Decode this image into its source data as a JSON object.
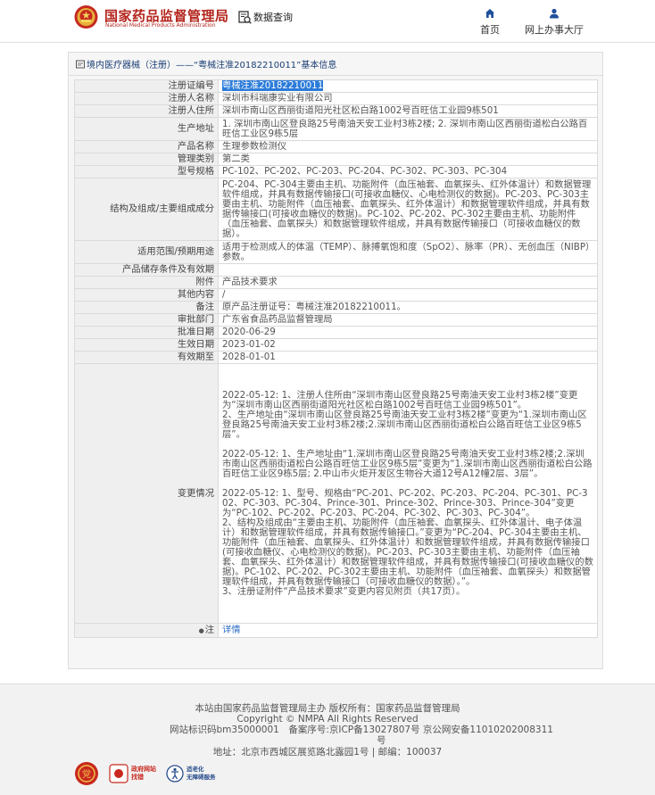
{
  "header": {
    "logo_cn": "国家药品监督管理局",
    "logo_en": "National Medical Products Administration",
    "nav_query": "数据查询",
    "nav_home": "首页",
    "nav_online": "网上办事大厅"
  },
  "panel": {
    "title": "境内医疗器械（注册）——“粤械注准20182210011”基本信息"
  },
  "rows": [
    {
      "key": "注册证编号",
      "value": "粤械注准20182210011"
    },
    {
      "key": "注册人名称",
      "value": "深圳市科瑞康实业有限公司"
    },
    {
      "key": "注册人住所",
      "value": "深圳市南山区西丽街道阳光社区松白路1002号百旺信工业园9栋501"
    },
    {
      "key": "生产地址",
      "value": "1. 深圳市南山区登良路25号南油天安工业村3栋2楼; 2. 深圳市南山区西丽街道松白公路百旺信工业区9栋5层"
    },
    {
      "key": "产品名称",
      "value": "生理参数检测仪"
    },
    {
      "key": "管理类别",
      "value": "第二类"
    },
    {
      "key": "型号规格",
      "value": "PC-102、PC-202、PC-203、PC-204、PC-302、PC-303、PC-304"
    },
    {
      "key": "结构及组成/主要组成成分",
      "value": "PC-204、PC-304主要由主机、功能附件（血压袖套、血氧探头、红外体温计）和数据管理软件组成，并具有数据传输接口(可接收血糖仪、心电检测仪的数据)。PC-203、PC-303主要由主机、功能附件（血压袖套、血氧探头、红外体温计）和数据管理软件组成，并具有数据传输接口(可接收血糖仪的数据)。PC-102、PC-202、PC-302主要由主机、功能附件（血压袖套、血氧探头）和数据管理软件组成，并具有数据传输接口（可接收血糖仪的数据）。"
    },
    {
      "key": "适用范围/预期用途",
      "value": "适用于检测成人的体温（TEMP）、脉搏氧饱和度（SpO2）、脉率（PR）、无创血压（NIBP）参数。"
    },
    {
      "key": "产品储存条件及有效期",
      "value": ""
    },
    {
      "key": "附件",
      "value": "产品技术要求"
    },
    {
      "key": "其他内容",
      "value": "/"
    },
    {
      "key": "备注",
      "value": "原产品注册证号：粤械注准20182210011。"
    },
    {
      "key": "审批部门",
      "value": "广东省食品药品监督管理局"
    },
    {
      "key": "批准日期",
      "value": "2020-06-29"
    },
    {
      "key": "生效日期",
      "value": "2023-01-02"
    },
    {
      "key": "有效期至",
      "value": "2028-01-01"
    }
  ],
  "changes": {
    "key": "变更情况",
    "blocks": [
      "2022-05-12: 1、注册人住所由“深圳市南山区登良路25号南油天安工业村3栋2楼”变更为“深圳市南山区西丽街道阳光社区松白路1002号百旺信工业园9栋501”。\n2、生产地址由“深圳市南山区登良路25号南油天安工业村3栋2楼”变更为“1.深圳市南山区登良路25号南油天安工业村3栋2楼;2.深圳市南山区西丽街道松白公路百旺信工业区9栋5层”。",
      "2022-05-12: 1、生产地址由“1.深圳市南山区登良路25号南油天安工业村3栋2楼;2.深圳市南山区西丽街道松白公路百旺信工业区9栋5层”变更为“1.深圳市南山区西丽街道松白公路百旺信工业区9栋5层; 2.中山市火炬开发区生物谷大道12号A12幢2层、3层”。",
      "2022-05-12: 1、型号、规格由“PC-201、PC-202、PC-203、PC-204、PC-301、PC-302、PC-303、PC-304、Prince-301、Prince-302、Prince-303、Prince-304”变更为“PC-102、PC-202、PC-203、PC-204、PC-302、PC-303、PC-304”。\n2、结构及组成由“主要由主机、功能附件（血压袖套、血氧探头、红外体温计、电子体温计）和数据管理软件组成，并具有数据传输接口。”变更为“PC-204、PC-304主要由主机、功能附件（血压袖套、血氧探头、红外体温计）和数据管理软件组成，并具有数据传输接口(可接收血糖仪、心电检测仪的数据)。PC-203、PC-303主要由主机、功能附件（血压袖套、血氧探头、红外体温计）和数据管理软件组成，并具有数据传输接口(可接收血糖仪的数据)。PC-102、PC-202、PC-302主要由主机、功能附件（血压袖套、血氧探头）和数据管理软件组成，并具有数据传输接口（可接收血糖仪的数据）。”。\n3、注册证附件“产品技术要求”变更内容见附页（共17页）。"
    ]
  },
  "note": {
    "key": "注",
    "link": "详情"
  },
  "footer": {
    "line1": "本站由国家药品监督管理局主办 版权所有：国家药品监督管理局",
    "line2": "Copyright © NMPA All Rights Reserved",
    "line3": "网站标识码bm35000001　备案序号:京ICP备13027807号 京公网安备11010202008311",
    "line3b": "号",
    "line4": "地址：北京市西城区展览路北露园1号 | 邮编：100037",
    "badge2_top": "政府网站",
    "badge2_bottom": "找错",
    "badge3_top": "适老化",
    "badge3_bottom": "无障碍服务"
  },
  "colors": {
    "brand_red": "#b4251d",
    "title_blue": "#1a3e74",
    "link_blue": "#2b6cc4",
    "highlight": "#2b7bd9"
  }
}
